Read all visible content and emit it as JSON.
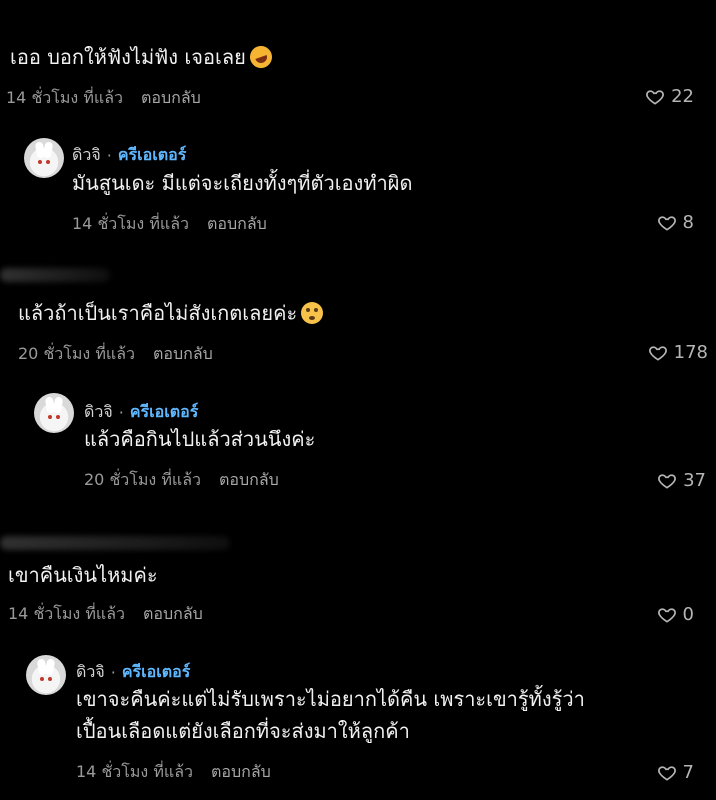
{
  "comments": [
    {
      "text": "เออ บอกให้ฟังไม่ฟัง เจอเลย",
      "emoji": "rolling-on-floor-laughing",
      "time": "14 ชั่วโมง ที่แล้ว",
      "reply_label": "ตอบกลับ",
      "likes": "22",
      "reply": {
        "author": "ดิวจิ",
        "separator": "·",
        "badge": "ครีเอเตอร์",
        "text_lines": [
          "มันสูนเดะ มีแต่จะเถียงทั้งๆที่ตัวเองทำผิด"
        ],
        "time": "14 ชั่วโมง ที่แล้ว",
        "reply_label": "ตอบกลับ",
        "likes": "8"
      }
    },
    {
      "text": "แล้วถ้าเป็นเราคือไม่สังเกตเลยค่ะ",
      "emoji": "flushed-face",
      "time": "20 ชั่วโมง ที่แล้ว",
      "reply_label": "ตอบกลับ",
      "likes": "178",
      "reply": {
        "author": "ดิวจิ",
        "separator": "·",
        "badge": "ครีเอเตอร์",
        "text_lines": [
          "แล้วคือกินไปแล้วส่วนนึงค่ะ"
        ],
        "time": "20 ชั่วโมง ที่แล้ว",
        "reply_label": "ตอบกลับ",
        "likes": "37"
      }
    },
    {
      "text": "เขาคืนเงินไหมค่ะ",
      "time": "14 ชั่วโมง ที่แล้ว",
      "reply_label": "ตอบกลับ",
      "likes": "0",
      "reply": {
        "author": "ดิวจิ",
        "separator": "·",
        "badge": "ครีเอเตอร์",
        "text_lines": [
          "เขาจะคืนค่ะแต่ไม่รับเพราะไม่อยากได้คืน เพราะเขารู้ทั้งรู้ว่า",
          "เปื้อนเลือดแต่ยังเลือกที่จะส่งมาให้ลูกค้า"
        ],
        "time": "14 ชั่วโมง ที่แล้ว",
        "reply_label": "ตอบกลับ",
        "likes": "7"
      }
    }
  ],
  "icons": {
    "like": "heart-outline-icon"
  },
  "colors": {
    "background": "#000000",
    "creator_badge": "#5fb8ff",
    "meta": "#9a9a9a"
  }
}
